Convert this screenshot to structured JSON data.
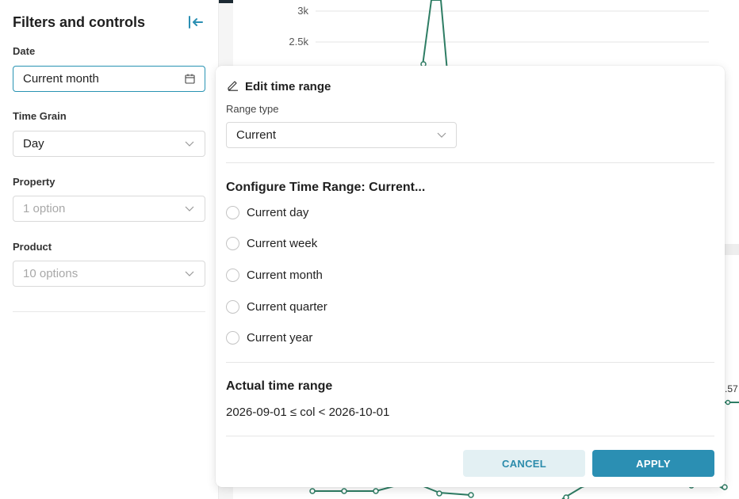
{
  "sidebar": {
    "title": "Filters and controls",
    "filters": [
      {
        "label": "Date",
        "value": "Current month",
        "icon": "calendar-icon"
      },
      {
        "label": "Time Grain",
        "value": "Day",
        "icon": "chevron-down-icon"
      },
      {
        "label": "Property",
        "placeholder": "1 option",
        "icon": "chevron-down-icon"
      },
      {
        "label": "Product",
        "placeholder": "10 options",
        "icon": "chevron-down-icon"
      }
    ]
  },
  "chart": {
    "y_ticks": [
      "3k",
      "2.5k"
    ],
    "partial_label": ".57"
  },
  "popover": {
    "title": "Edit time range",
    "range_type_label": "Range type",
    "range_type_value": "Current",
    "configure_title": "Configure Time Range: Current...",
    "options": [
      "Current day",
      "Current week",
      "Current month",
      "Current quarter",
      "Current year"
    ],
    "actual_title": "Actual time range",
    "actual_value": "2026-09-01 ≤ col < 2026-10-01",
    "cancel_label": "CANCEL",
    "apply_label": "APPLY"
  },
  "colors": {
    "accent": "#2b8fb3",
    "line": "#2e7d64"
  }
}
